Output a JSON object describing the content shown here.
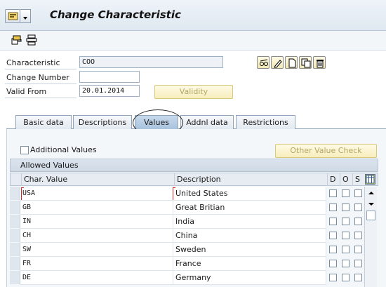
{
  "window": {
    "title": "Change Characteristic"
  },
  "header": {
    "characteristic_label": "Characteristic",
    "characteristic_value": "COO",
    "change_number_label": "Change Number",
    "change_number_value": "",
    "valid_from_label": "Valid From",
    "valid_from_value": "20.01.2014",
    "validity_button": "Validity"
  },
  "tabs": [
    {
      "label": "Basic data"
    },
    {
      "label": "Descriptions"
    },
    {
      "label": "Values"
    },
    {
      "label": "Addnl data"
    },
    {
      "label": "Restrictions"
    }
  ],
  "values_tab": {
    "additional_values_label": "Additional Values",
    "other_value_check_button": "Other Value Check",
    "table_title": "Allowed Values",
    "columns": {
      "char_value": "Char. Value",
      "description": "Description",
      "d": "D",
      "o": "O",
      "s": "S"
    },
    "rows": [
      {
        "value": "USA",
        "description": "United States"
      },
      {
        "value": "GB",
        "description": "Great Britian"
      },
      {
        "value": "IN",
        "description": "India"
      },
      {
        "value": "CH",
        "description": "China"
      },
      {
        "value": "SW",
        "description": "Sweden"
      },
      {
        "value": "FR",
        "description": "France"
      },
      {
        "value": "DE",
        "description": "Germany"
      }
    ]
  }
}
